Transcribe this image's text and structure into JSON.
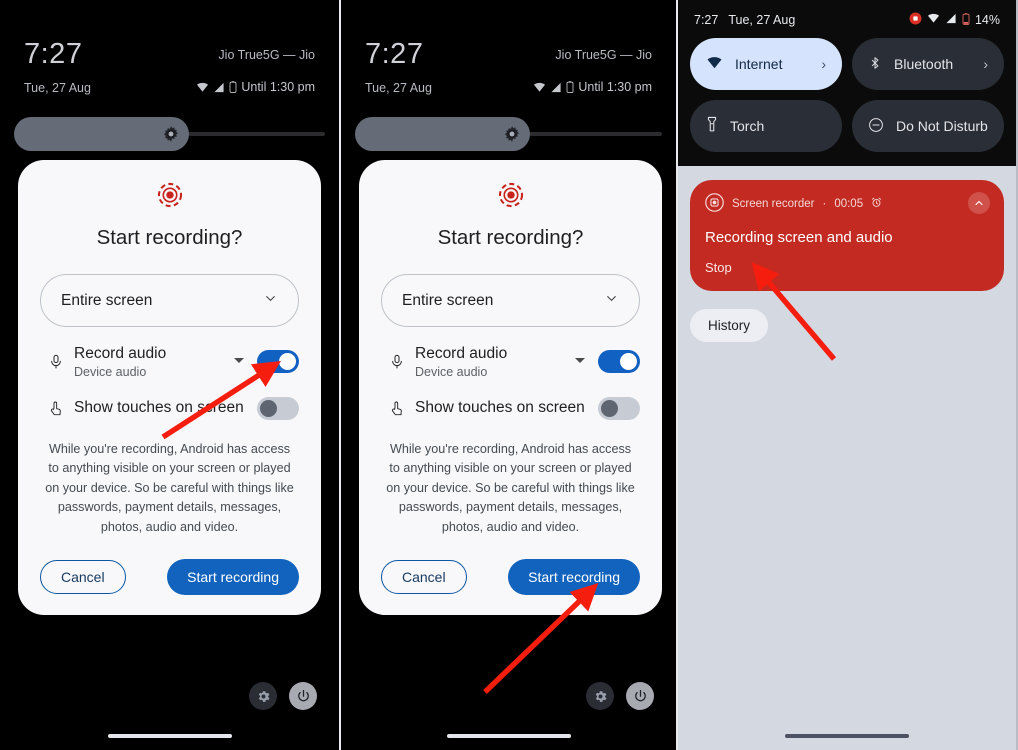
{
  "panels": [
    {
      "id": "panel-1",
      "status": {
        "time": "7:27",
        "date": "Tue, 27 Aug",
        "carrier": "Jio True5G — Jio",
        "battery_note": "Until 1:30 pm"
      },
      "dialog": {
        "icon": "screen-record-icon",
        "title": "Start recording?",
        "select_value": "Entire screen",
        "record_audio": {
          "label": "Record audio",
          "sub": "Device audio",
          "state": "on"
        },
        "show_touches": {
          "label": "Show touches on screen",
          "state": "off"
        },
        "disclaimer": "While you're recording, Android has access to anything visible on your screen or played on your device. So be careful with things like passwords, payment details, messages, photos, audio and video.",
        "cancel_label": "Cancel",
        "start_label": "Start recording"
      },
      "annotation": "arrow pointing to Record audio toggle"
    },
    {
      "id": "panel-2",
      "status": {
        "time": "7:27",
        "date": "Tue, 27 Aug",
        "carrier": "Jio True5G — Jio",
        "battery_note": "Until 1:30 pm"
      },
      "dialog": {
        "icon": "screen-record-icon",
        "title": "Start recording?",
        "select_value": "Entire screen",
        "record_audio": {
          "label": "Record audio",
          "sub": "Device audio",
          "state": "on"
        },
        "show_touches": {
          "label": "Show touches on screen",
          "state": "off"
        },
        "disclaimer": "While you're recording, Android has access to anything visible on your screen or played on your device. So be careful with things like passwords, payment details, messages, photos, audio and video.",
        "cancel_label": "Cancel",
        "start_label": "Start recording"
      },
      "annotation": "arrow pointing to Start recording button"
    }
  ],
  "panel3": {
    "status": {
      "time": "7:27",
      "date": "Tue, 27 Aug",
      "battery_percent": "14%"
    },
    "tiles": [
      {
        "label": "Internet",
        "icon": "wifi-icon",
        "state": "active",
        "chevron": "›"
      },
      {
        "label": "Bluetooth",
        "icon": "bluetooth-icon",
        "state": "inactive",
        "chevron": "›"
      },
      {
        "label": "Torch",
        "icon": "flashlight-icon",
        "state": "inactive",
        "chevron": ""
      },
      {
        "label": "Do Not Disturb",
        "icon": "do-not-disturb-icon",
        "state": "inactive",
        "chevron": ""
      }
    ],
    "notification": {
      "app": "Screen recorder",
      "separator": "·",
      "timer": "00:05",
      "alarm_icon": "alarm-icon",
      "title": "Recording screen and audio",
      "action": "Stop",
      "collapse_icon": "chevron-up-icon"
    },
    "history_label": "History",
    "annotation": "arrow pointing to Stop action"
  }
}
